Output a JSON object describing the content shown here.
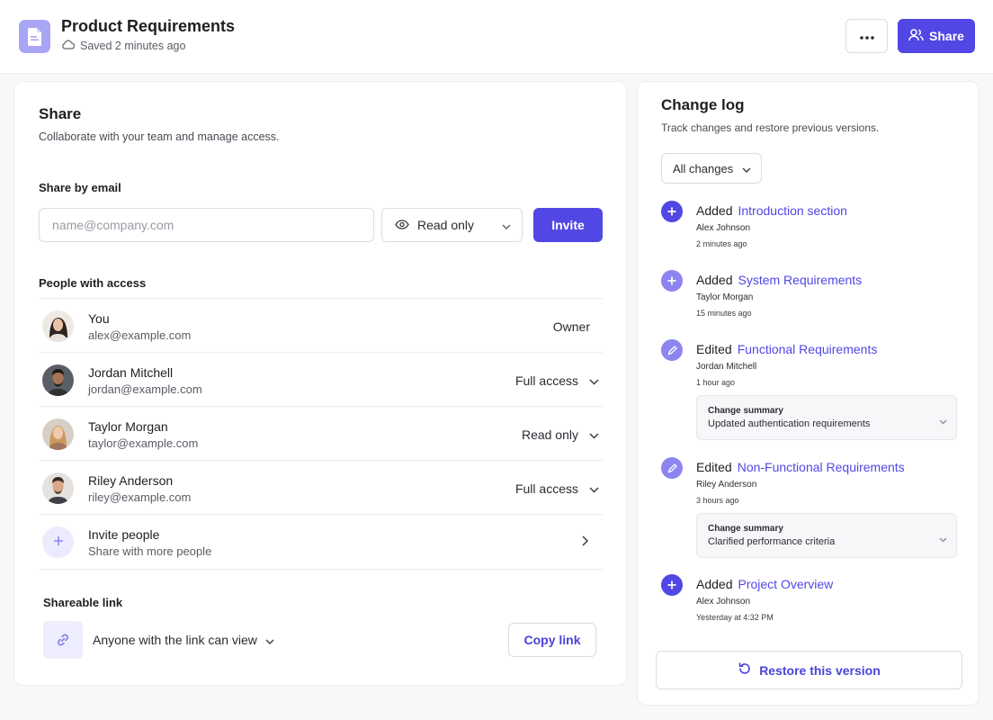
{
  "header": {
    "title": "Product Requirements",
    "saved_status": "Saved 2 minutes ago",
    "more_icon": "ellipsis-icon",
    "share_label": "Share",
    "accent_color": "#5147e5"
  },
  "share": {
    "title": "Share",
    "subtitle": "Collaborate with your team and manage access.",
    "by_email_label": "Share by email",
    "email_placeholder": "name@company.com",
    "email_value": "",
    "permission_selected": "Read only",
    "invite_label": "Invite",
    "people_label": "People with access",
    "people": [
      {
        "name": "You",
        "email": "alex@example.com",
        "role": "Owner"
      },
      {
        "name": "Jordan Mitchell",
        "email": "jordan@example.com",
        "role": "Full access"
      },
      {
        "name": "Taylor Morgan",
        "email": "taylor@example.com",
        "role": "Read only"
      },
      {
        "name": "Riley Anderson",
        "email": "riley@example.com",
        "role": "Full access"
      }
    ],
    "invite_people": {
      "title": "Invite people",
      "subtitle": "Share with more people"
    },
    "link_label": "Shareable link",
    "link_permission": "Anyone with the link can view",
    "copy_label": "Copy link"
  },
  "changelog": {
    "title": "Change log",
    "subtitle": "Track changes and restore previous versions.",
    "filter": "All changes",
    "items": [
      {
        "action": "Added",
        "target": "Introduction section",
        "user": "Alex Johnson",
        "time": "2 minutes ago",
        "icon": "plus-icon"
      },
      {
        "action": "Added",
        "target": "System Requirements",
        "user": "Taylor Morgan",
        "time": "15 minutes ago",
        "icon": "plus-icon"
      },
      {
        "action": "Edited",
        "target": "Functional Requirements",
        "user": "Jordan Mitchell",
        "time": "1 hour ago",
        "icon": "pencil-icon",
        "summary_label": "Change summary",
        "summary": "Updated authentication requirements"
      },
      {
        "action": "Edited",
        "target": "Non-Functional Requirements",
        "user": "Riley Anderson",
        "time": "3 hours ago",
        "icon": "pencil-icon",
        "summary_label": "Change summary",
        "summary": "Clarified performance criteria"
      },
      {
        "action": "Added",
        "target": "Project Overview",
        "user": "Alex Johnson",
        "time": "Yesterday at 4:32 PM",
        "icon": "plus-icon"
      }
    ],
    "restore_label": "Restore this version"
  }
}
